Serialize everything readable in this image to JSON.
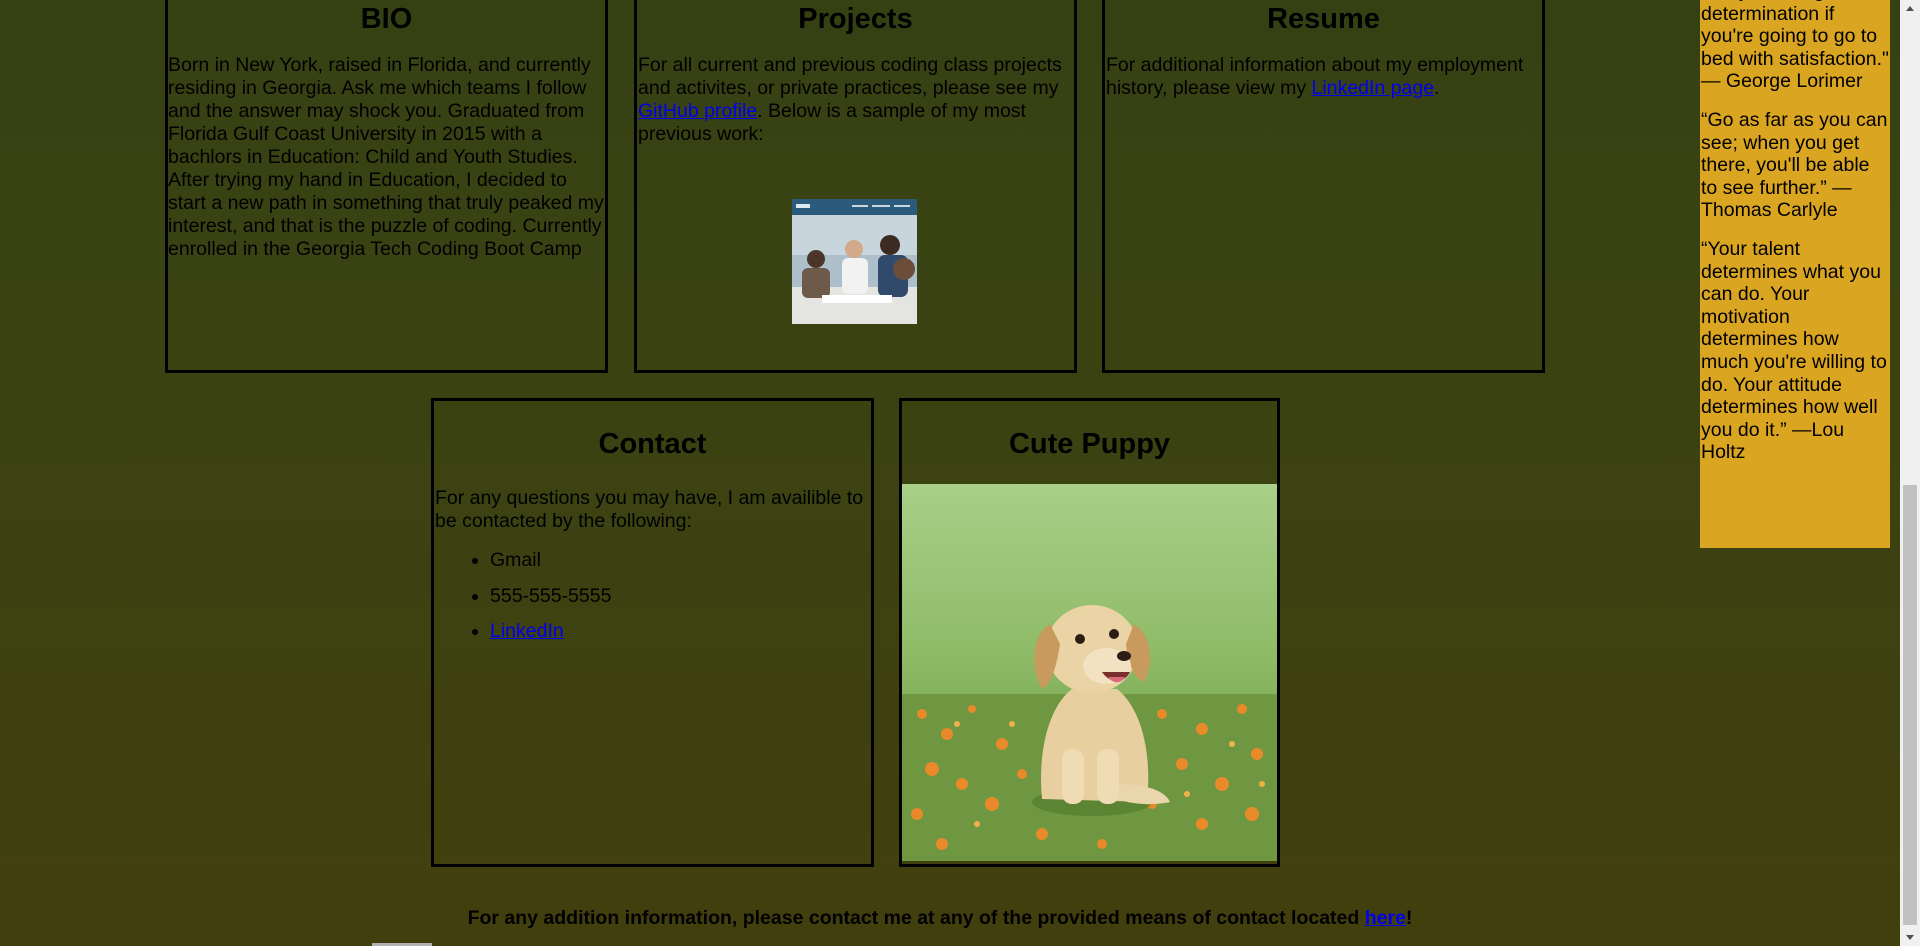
{
  "bio": {
    "title": "BIO",
    "text": "Born in New York, raised in Florida, and currently residing in Georgia. Ask me which teams I follow and the answer may shock you. Graduated from Florida Gulf Coast University in 2015 with a bachlors in Education: Child and Youth Studies. After trying my hand in Education, I decided to start a new path in something that truly peaked my interest, and that is the puzzle of coding. Currently enrolled in the Georgia Tech Coding Boot Camp"
  },
  "projects": {
    "title": "Projects",
    "text_before": "For all current and previous coding class projects and activites, or private practices, please see my ",
    "link": "GitHub profile",
    "text_after": ". Below is a sample of my most previous work:"
  },
  "resume": {
    "title": "Resume",
    "text_before": "For additional information about my employment history, please view my ",
    "link": "LinkedIn page",
    "text_after": "."
  },
  "contact": {
    "title": "Contact",
    "text": "For any questions you may have, I am availible to be contacted by the following:",
    "items": [
      "Gmail",
      "555-555-5555",
      "LinkedIn"
    ]
  },
  "puppy": {
    "title": "Cute Puppy"
  },
  "quotes": {
    "partial": "every morning with determination if you're going to go to bed with satisfaction.\" — George Lorimer",
    "q2": "“Go as far as you can see; when you get there, you'll be able to see further.” —Thomas Carlyle",
    "q3": "“Your talent determines what you can do. Your motivation determines how much you're willing to do. Your attitude determines how well you do it.” —Lou Holtz"
  },
  "footer": {
    "text_before": "For any addition information, please contact me at any of the provided means of contact located ",
    "link": "here",
    "text_after": "!"
  },
  "colors": {
    "background_top": "#364113",
    "background_bottom": "#423f0e",
    "sidebar": "#daa520",
    "link": "#0000ee"
  }
}
